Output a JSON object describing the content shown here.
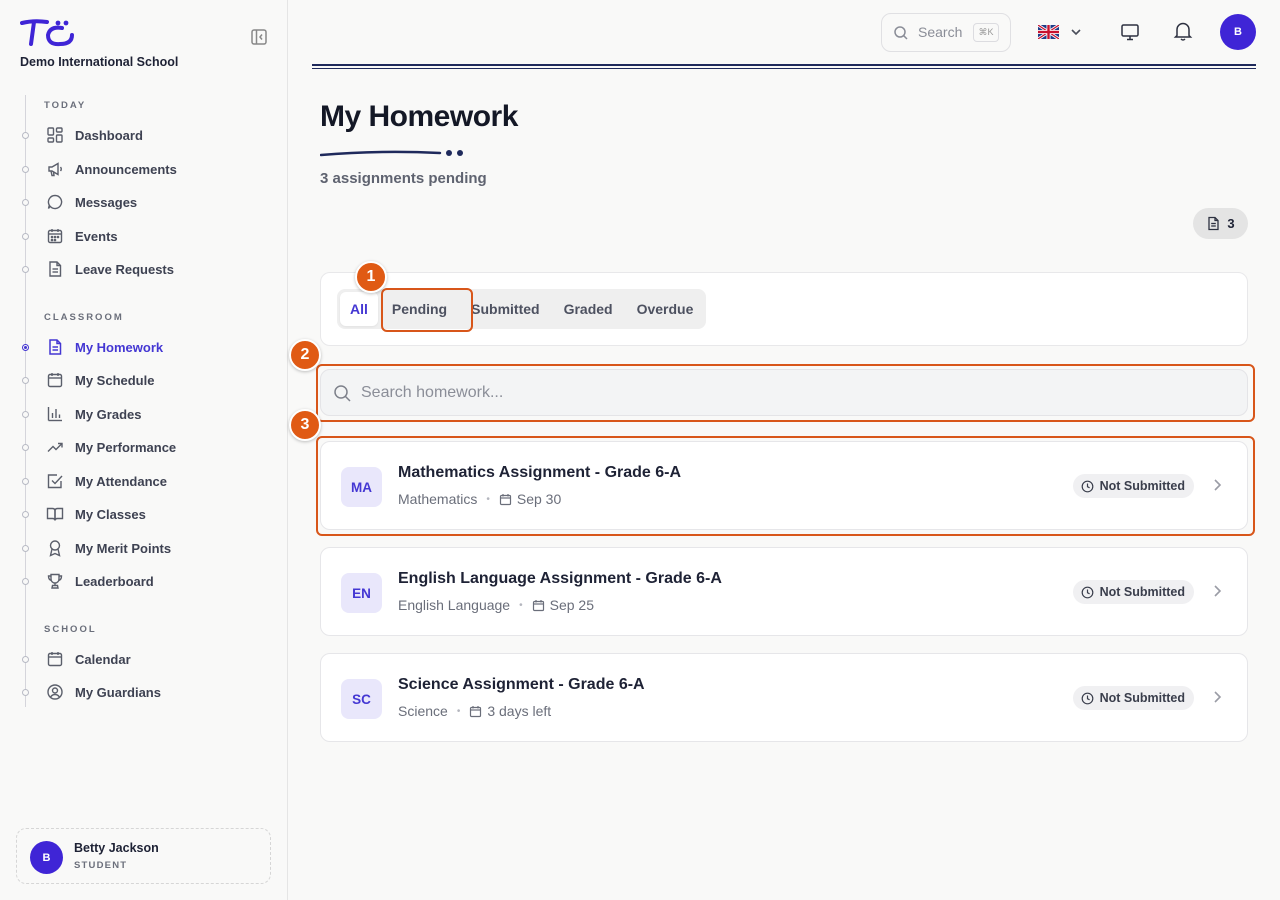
{
  "app": {
    "school_name": "Demo International School"
  },
  "colors": {
    "accent": "#4437d3",
    "avatar": "#3f25d6",
    "callout": "#d8561a",
    "header_rule": "#1f2a5c"
  },
  "sidebar": {
    "sections": [
      {
        "label": "TODAY"
      },
      {
        "label": "CLASSROOM"
      },
      {
        "label": "SCHOOL"
      }
    ],
    "items": [
      {
        "label": "Dashboard",
        "icon": "dashboard-grid-icon"
      },
      {
        "label": "Announcements",
        "icon": "megaphone-icon"
      },
      {
        "label": "Messages",
        "icon": "chat-bubble-icon"
      },
      {
        "label": "Events",
        "icon": "calendar-grid-icon"
      },
      {
        "label": "Leave Requests",
        "icon": "document-icon"
      },
      {
        "label": "My Homework",
        "icon": "document-text-icon",
        "active": true
      },
      {
        "label": "My Schedule",
        "icon": "calendar-icon"
      },
      {
        "label": "My Grades",
        "icon": "bar-chart-icon"
      },
      {
        "label": "My Performance",
        "icon": "trending-up-icon"
      },
      {
        "label": "My Attendance",
        "icon": "checkbox-icon"
      },
      {
        "label": "My Classes",
        "icon": "open-book-icon"
      },
      {
        "label": "My Merit Points",
        "icon": "award-ribbon-icon"
      },
      {
        "label": "Leaderboard",
        "icon": "trophy-icon"
      },
      {
        "label": "Calendar",
        "icon": "calendar-icon"
      },
      {
        "label": "My Guardians",
        "icon": "user-circle-icon"
      }
    ]
  },
  "user": {
    "initial": "B",
    "name": "Betty Jackson",
    "role": "STUDENT"
  },
  "topbar": {
    "search_label": "Search",
    "search_shortcut": "⌘K",
    "language_flag": "uk-flag-icon",
    "avatar_initial": "B"
  },
  "page": {
    "title": "My Homework",
    "subtitle": "3 assignments pending",
    "count_badge": "3"
  },
  "tabs": [
    {
      "label": "All",
      "active": true
    },
    {
      "label": "Pending"
    },
    {
      "label": "Submitted"
    },
    {
      "label": "Graded"
    },
    {
      "label": "Overdue"
    }
  ],
  "search": {
    "placeholder": "Search homework..."
  },
  "homework": [
    {
      "abbr": "MA",
      "title": "Mathematics Assignment - Grade 6-A",
      "subject": "Mathematics",
      "due": "Sep 30",
      "status": "Not Submitted"
    },
    {
      "abbr": "EN",
      "title": "English Language Assignment - Grade 6-A",
      "subject": "English Language",
      "due": "Sep 25",
      "status": "Not Submitted"
    },
    {
      "abbr": "SC",
      "title": "Science Assignment - Grade 6-A",
      "subject": "Science",
      "due": "3 days left",
      "status": "Not Submitted"
    }
  ],
  "callouts": [
    "1",
    "2",
    "3"
  ]
}
